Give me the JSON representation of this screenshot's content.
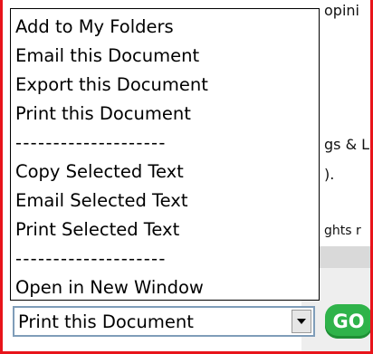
{
  "background": {
    "top_text": "opini",
    "line_1": "gs & L",
    "line_2": ").",
    "small_text": "ghts r"
  },
  "dropdown": {
    "options": [
      "Add to My Folders",
      "Email this Document",
      "Export this Document",
      "Print this Document",
      "--------------------",
      "Copy Selected Text",
      "Email Selected Text",
      "Print Selected Text",
      "--------------------",
      "Open in New Window"
    ],
    "selected": "Print this Document"
  },
  "go_button": {
    "label": "GO",
    "color": "#2fb34a"
  },
  "colors": {
    "frame": "#e8141b",
    "select_border": "#7f9db9"
  }
}
